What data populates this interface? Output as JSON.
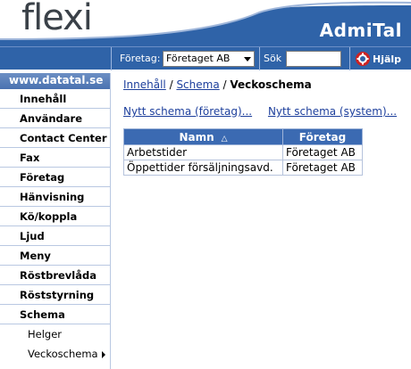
{
  "header": {
    "logo": "flexi",
    "app_title": "AdmiTal"
  },
  "toolbar": {
    "company_label": "Företag:",
    "company_value": "Företaget AB",
    "search_label": "Sök",
    "search_value": "",
    "help_label": "Hjälp"
  },
  "sidebar": {
    "header": "www.datatal.se",
    "items": [
      {
        "label": "Innehåll"
      },
      {
        "label": "Användare"
      },
      {
        "label": "Contact Center"
      },
      {
        "label": "Fax"
      },
      {
        "label": "Företag"
      },
      {
        "label": "Hänvisning"
      },
      {
        "label": "Kö/koppla"
      },
      {
        "label": "Ljud"
      },
      {
        "label": "Meny"
      },
      {
        "label": "Röstbrevlåda"
      },
      {
        "label": "Röststyrning"
      },
      {
        "label": "Schema"
      },
      {
        "label": "Helger"
      },
      {
        "label": "Veckoschema"
      }
    ]
  },
  "breadcrumb": {
    "crumb1": "Innehåll",
    "sep": " / ",
    "crumb2": "Schema",
    "current": "Veckoschema"
  },
  "actions": {
    "new_company": "Nytt schema (företag)...",
    "new_system": "Nytt schema (system)..."
  },
  "table": {
    "columns": [
      "Namn",
      "Företag"
    ],
    "sort_indicator": "△",
    "rows": [
      [
        "Arbetstider",
        "Företaget AB"
      ],
      [
        "Öppettider försäljningsavd.",
        "Företaget AB"
      ]
    ]
  },
  "colors": {
    "toolbar_bg": "#2f63a8",
    "table_header_bg": "#3b6ab2",
    "link": "#1d3f9c"
  }
}
